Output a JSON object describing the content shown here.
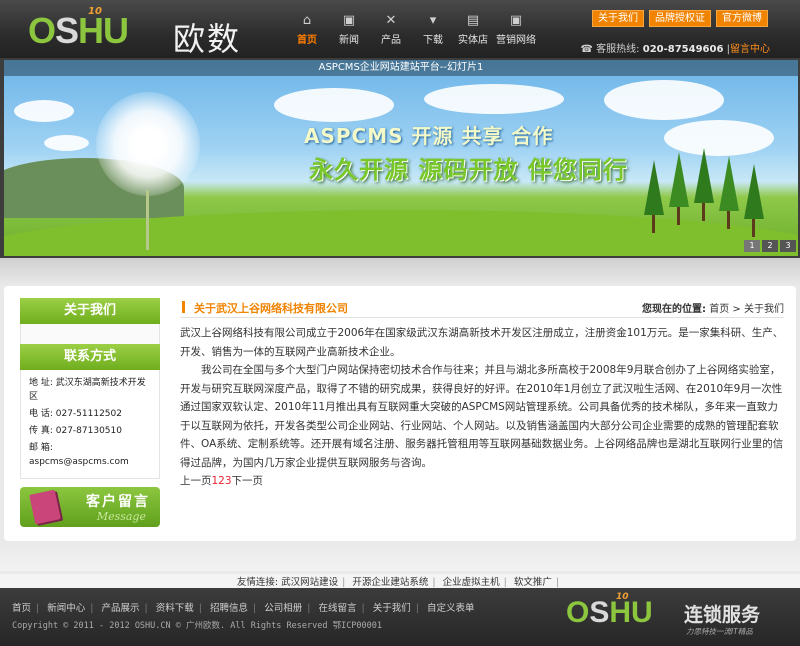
{
  "logo": {
    "letters_o": "O",
    "letters_s": "S",
    "letters_hu": "HU",
    "ten": "10",
    "name_cn": "欧数"
  },
  "nav": [
    {
      "label": "首页",
      "icon": "home-icon",
      "glyph": "⌂",
      "active": true
    },
    {
      "label": "新闻",
      "icon": "chat-icon",
      "glyph": "▣"
    },
    {
      "label": "产品",
      "icon": "tools-icon",
      "glyph": "✕"
    },
    {
      "label": "下载",
      "icon": "download-icon",
      "glyph": "▾"
    },
    {
      "label": "实体店",
      "icon": "store-icon",
      "glyph": "▤"
    },
    {
      "label": "营销网络",
      "icon": "network-icon",
      "glyph": "▣"
    }
  ],
  "toplinks": [
    "关于我们",
    "品牌授权证",
    "官方微博"
  ],
  "hotline": {
    "label": "客服热线:",
    "number": "020-87549606",
    "sep": "|",
    "message": "留言中心"
  },
  "banner": {
    "caption": "ASPCMS企业网站建站平台--幻灯片1",
    "slogan1": "ASPCMS 开源   共享  合作",
    "slogan2": "永久开源  源码开放  伴您同行",
    "pages": [
      "1",
      "2",
      "3"
    ]
  },
  "sidebar": {
    "about_title": "关于我们",
    "contact_title": "联系方式",
    "contact": [
      "地 址: 武汉东湖高新技术开发区",
      "电 话: 027-51112502",
      "传 真: 027-87130510",
      "邮 箱: aspcms@aspcms.com"
    ],
    "message_title": "客户留言",
    "message_sub": "Message"
  },
  "main": {
    "title": "关于武汉上谷网络科技有限公司",
    "crumb_label": "您现在的位置:",
    "crumb_home": "首页",
    "crumb_sep": ">",
    "crumb_current": "关于我们",
    "para1": "武汉上谷网络科技有限公司成立于2006年在国家级武汉东湖高新技术开发区注册成立，注册资金101万元。是一家集科研、生产、开发、销售为一体的互联网产业高新技术企业。",
    "para2": "我公司在全国与多个大型门户网站保持密切技术合作与往来；并且与湖北多所高校于2008年9月联合创办了上谷网络实验室，开发与研究互联网深度产品，取得了不错的研究成果，获得良好的好评。在2010年1月创立了武汉啦生活网、在2010年9月一次性通过国家双软认定、2010年11月推出具有互联网重大突破的ASPCMS网站管理系统。公司具备优秀的技术梯队，多年来一直致力于以互联网为依托，开发各类型公司企业网站、行业网站、个人网站。以及销售涵盖国内大部分公司企业需要的成熟的管理配套软件、OA系统、定制系统等。还开展有域名注册、服务器托管租用等互联网基础数据业务。上谷网络品牌也是湖北互联网行业里的信得过品牌，为国内几万家企业提供互联网服务与咨询。",
    "prev": "上一页",
    "page_nums": "123",
    "next": "下一页"
  },
  "friend_links": {
    "label": "友情连接:",
    "items": [
      "武汉网站建设",
      "开源企业建站系统",
      "企业虚拟主机",
      "软文推广"
    ]
  },
  "footer": {
    "nav": [
      "首页",
      "新闻中心",
      "产品展示",
      "资料下载",
      "招聘信息",
      "公司相册",
      "在线留言",
      "关于我们",
      "自定义表单"
    ],
    "copyright": "Copyright © 2011 - 2012 OSHU.CN © 广州欧数. All Rights Reserved 鄂ICP00001",
    "logo_o": "O",
    "logo_s": "S",
    "logo_hu": "HU",
    "logo_ten": "10",
    "logo_cn": "连锁服务",
    "logo_tag": "力思特技一流IT精品"
  }
}
